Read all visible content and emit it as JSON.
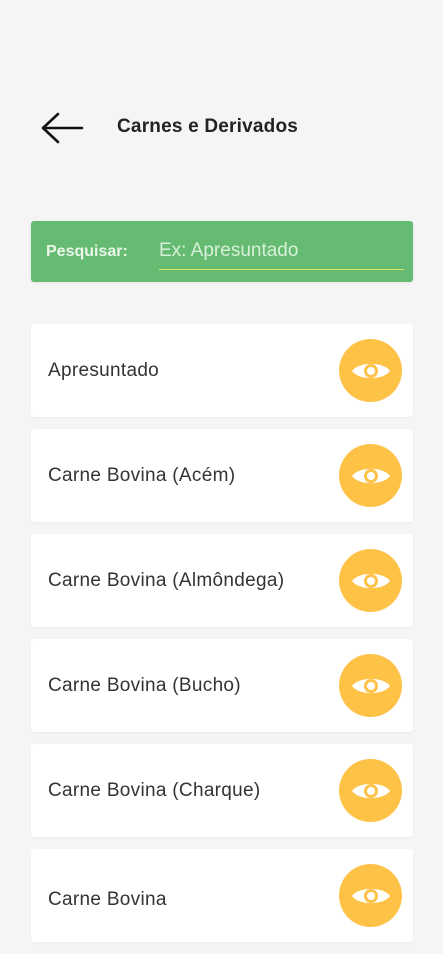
{
  "header": {
    "title": "Carnes e Derivados",
    "back_icon": "arrow-left-icon"
  },
  "search": {
    "label": "Pesquisar:",
    "placeholder": "Ex: Apresuntado",
    "value": ""
  },
  "colors": {
    "background": "#f5f5f5",
    "search_bar": "#66bb73",
    "search_underline": "#d9e86a",
    "view_button": "#fec247",
    "card": "#ffffff"
  },
  "items": [
    {
      "label": "Apresuntado",
      "icon": "eye-icon"
    },
    {
      "label": "Carne Bovina (Acém)",
      "icon": "eye-icon"
    },
    {
      "label": "Carne Bovina (Almôndega)",
      "icon": "eye-icon"
    },
    {
      "label": "Carne Bovina (Bucho)",
      "icon": "eye-icon"
    },
    {
      "label": "Carne Bovina (Charque)",
      "icon": "eye-icon"
    },
    {
      "label": "Carne Bovina",
      "icon": "eye-icon"
    }
  ]
}
